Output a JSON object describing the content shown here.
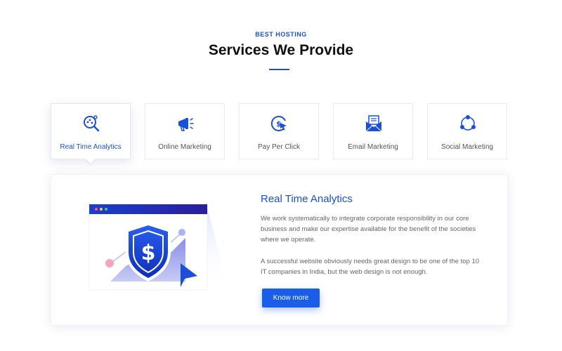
{
  "header": {
    "eyebrow": "BEST HOSTING",
    "title": "Services We Provide"
  },
  "tabs": [
    {
      "label": "Real Time Analytics",
      "icon": "analytics-magnifier-icon",
      "active": true
    },
    {
      "label": "Online Marketing",
      "icon": "megaphone-icon",
      "active": false
    },
    {
      "label": "Pay Per Click",
      "icon": "pay-per-click-icon",
      "active": false
    },
    {
      "label": "Email Marketing",
      "icon": "email-icon",
      "active": false
    },
    {
      "label": "Social Marketing",
      "icon": "social-network-icon",
      "active": false
    }
  ],
  "panel": {
    "title": "Real Time Analytics",
    "paragraph1": "We work systematically to integrate corporate responsibility in our core business and make our expertise available for the benefit of the societies where we operate.",
    "paragraph2": "A successful website obviously needs great design to be one of the top 10 IT companies in India, but the web design is not enough.",
    "button_label": "Know more",
    "illustration_icon": "dollar-shield-icon"
  },
  "colors": {
    "accent": "#1a4fd8",
    "button": "#1a5de8",
    "text_muted": "#666666"
  }
}
